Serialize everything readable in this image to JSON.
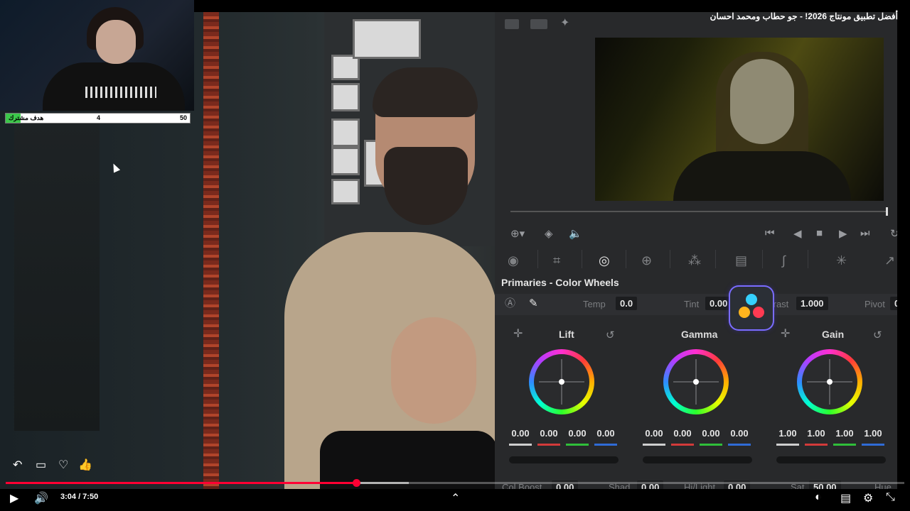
{
  "video": {
    "title": "أفضل تطبيق مونتاج 2026! - جو حطاب ومحمد احسان"
  },
  "overlay": {
    "goal_label": "هدف مشترك",
    "goal_current": "4",
    "goal_target": "50",
    "goal_progress": 0.08
  },
  "resolve": {
    "panel_title": "Primaries - Color Wheels",
    "temp_label": "Temp",
    "temp_value": "0.0",
    "tint_label": "Tint",
    "tint_value": "0.00",
    "contrast_label": "trast",
    "contrast_value": "1.000",
    "pivot_label": "Pivot",
    "pivot_value": "0",
    "wheels": [
      {
        "name": "Lift",
        "values": [
          "0.00",
          "0.00",
          "0.00",
          "0.00"
        ]
      },
      {
        "name": "Gamma",
        "values": [
          "0.00",
          "0.00",
          "0.00",
          "0.00"
        ]
      },
      {
        "name": "Gain",
        "values": [
          "1.00",
          "1.00",
          "1.00",
          "1.00"
        ]
      }
    ],
    "bottom": {
      "col_boost_label": "Col Boost",
      "col_boost_value": "0.00",
      "shad_label": "Shad",
      "shad_value": "0.00",
      "hilight_label": "Hi/Light",
      "hilight_value": "0.00",
      "sat_label": "Sat",
      "sat_value": "50.00",
      "hue_label": "Hue"
    },
    "colors": {
      "red": "#d23a3a",
      "green": "#2fbf3a",
      "blue": "#2f6bd6",
      "white": "#cfcfcf"
    }
  },
  "player": {
    "current_time": "3:04",
    "duration": "7:50",
    "time_display": "3:04 / 7:50",
    "progress_fraction": 0.39,
    "accent_color": "#ff0033",
    "icons": [
      "play-icon",
      "volume-icon",
      "chevron-up-icon",
      "autoplay-toggle-icon",
      "captions-icon",
      "settings-icon",
      "exit-fullscreen-icon",
      "share-icon",
      "comment-icon",
      "dislike-icon",
      "like-icon"
    ]
  }
}
